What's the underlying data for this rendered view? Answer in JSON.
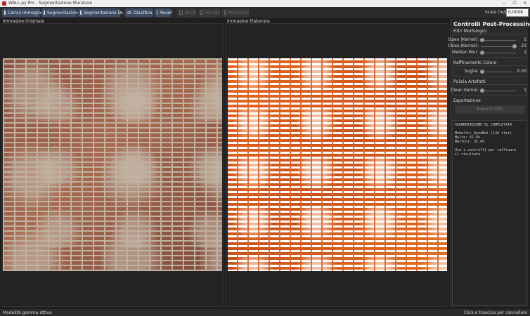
{
  "window": {
    "title": "WALL.py Pro - Segmentazione Murature",
    "controls": {
      "minimize": "—",
      "maximize": "☐",
      "close": "✕"
    }
  },
  "toolbar": {
    "load_image": "Carica Immagine",
    "segmentation": "Segmentazione",
    "segmentation_dl": "Segmentazione DL",
    "disable": "Disattiva",
    "reset": "Reset",
    "bordi": "Bordi",
    "sfondo": "Sfondo",
    "maschera": "Maschera",
    "scale_label": "Scala (m/px):",
    "scale_value": "0.0008"
  },
  "panels": {
    "original_label": "Immagine Originale",
    "processed_label": "Immagine Elaborata"
  },
  "sidebar": {
    "title": "Controlli Post-Processing",
    "filters": {
      "label": "Filtri Morfologici",
      "open_label": "Open (Kernel):",
      "open_value": "1",
      "close_label": "Close (Kernel):",
      "close_value": "21",
      "median_label": "Median Blur:",
      "median_value": "1"
    },
    "color": {
      "label": "Raffinamento Colore",
      "threshold_label": "Soglia:",
      "threshold_value": "0.00"
    },
    "artifacts": {
      "label": "Pulizia Artefatti",
      "clean_label": "Clean Kernel:",
      "clean_value": "1"
    },
    "export": {
      "label": "Esportazione",
      "button": "Esporta DXF"
    },
    "log": [
      "SEGMENTAZIONE DL COMPLETATA",
      "",
      "Modello: DynoNet (12k iter)",
      "Malta: 67.6%",
      "Mattoni: 32.4%",
      "",
      "Usa i controlli per raffinare",
      "il risultato."
    ]
  },
  "status": {
    "left": "Modalità gomma attiva",
    "right": "Click e trascina per cancellare"
  },
  "colors": {
    "accent": "#3d4d63",
    "mask_orange": "#e0621e"
  }
}
